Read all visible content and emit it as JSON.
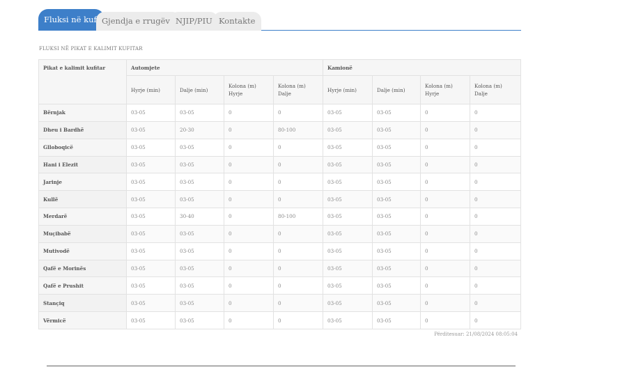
{
  "tabs": [
    "Fluksi në kufi",
    "Gjendja e rrugëve",
    "NJIP/PIU",
    "Kontakte"
  ],
  "table": {
    "title": "FLUKSI NË PIKAT E KALIMIT KUFITAR",
    "header": {
      "point": "Pikat e kalimit kufitar",
      "group_cars": "Automjete",
      "group_trucks": "Kamionë",
      "subcolumns": [
        "Hyrje (min)",
        "Dalje (min)",
        "Kolona (m) Hyrje",
        "Kolona (m) Dalje",
        "Hyrje (min)",
        "Dalje (min)",
        "Kolona (m) Hyrje",
        "Kolona (m) Dalje"
      ]
    },
    "rows": [
      {
        "name": "Bërnjak",
        "values": [
          "03-05",
          "03-05",
          "0",
          "0",
          "03-05",
          "03-05",
          "0",
          "0"
        ]
      },
      {
        "name": "Dheu i Bardhë",
        "values": [
          "03-05",
          "20-30",
          "0",
          "80-100",
          "03-05",
          "03-05",
          "0",
          "0"
        ]
      },
      {
        "name": "Glloboqicë",
        "values": [
          "03-05",
          "03-05",
          "0",
          "0",
          "03-05",
          "03-05",
          "0",
          "0"
        ]
      },
      {
        "name": "Hani i Elezit",
        "values": [
          "03-05",
          "03-05",
          "0",
          "0",
          "03-05",
          "03-05",
          "0",
          "0"
        ]
      },
      {
        "name": "Jarinje",
        "values": [
          "03-05",
          "03-05",
          "0",
          "0",
          "03-05",
          "03-05",
          "0",
          "0"
        ]
      },
      {
        "name": "Kullë",
        "values": [
          "03-05",
          "03-05",
          "0",
          "0",
          "03-05",
          "03-05",
          "0",
          "0"
        ]
      },
      {
        "name": "Merdarë",
        "values": [
          "03-05",
          "30-40",
          "0",
          "80-100",
          "03-05",
          "03-05",
          "0",
          "0"
        ]
      },
      {
        "name": "Muçibabë",
        "values": [
          "03-05",
          "03-05",
          "0",
          "0",
          "03-05",
          "03-05",
          "0",
          "0"
        ]
      },
      {
        "name": "Mutivodë",
        "values": [
          "03-05",
          "03-05",
          "0",
          "0",
          "03-05",
          "03-05",
          "0",
          "0"
        ]
      },
      {
        "name": "Qafë e Morinës",
        "values": [
          "03-05",
          "03-05",
          "0",
          "0",
          "03-05",
          "03-05",
          "0",
          "0"
        ]
      },
      {
        "name": "Qafë e Prushit",
        "values": [
          "03-05",
          "03-05",
          "0",
          "0",
          "03-05",
          "03-05",
          "0",
          "0"
        ]
      },
      {
        "name": "Stançiq",
        "values": [
          "03-05",
          "03-05",
          "0",
          "0",
          "03-05",
          "03-05",
          "0",
          "0"
        ]
      },
      {
        "name": "Vërmicë",
        "values": [
          "03-05",
          "03-05",
          "0",
          "0",
          "03-05",
          "03-05",
          "0",
          "0"
        ]
      }
    ]
  },
  "updated": "Përditesuar: 21/08/2024 08:05:04"
}
